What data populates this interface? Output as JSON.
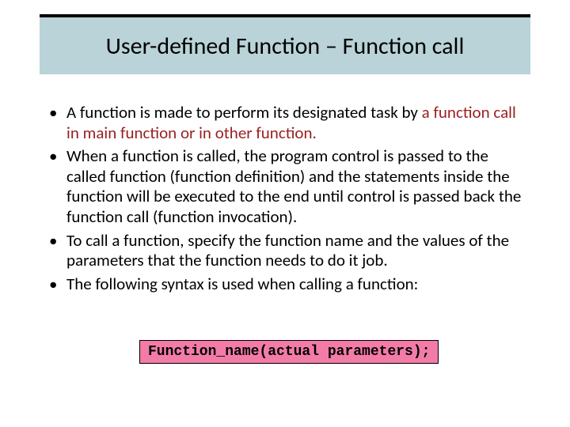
{
  "title": "User-defined Function – Function call",
  "bullets": [
    {
      "pre": "A function is made to perform its designated task by ",
      "hl": "a function call in main function or in other function.",
      "post": ""
    },
    {
      "pre": "When a function is called, the program control is passed to the called function (function definition) and the statements inside the function will be executed to the end until control is passed back the function call (function invocation).",
      "hl": "",
      "post": ""
    },
    {
      "pre": "To call a function, specify the function name and the values of the parameters that the function needs to do it job.",
      "hl": "",
      "post": ""
    },
    {
      "pre": "The following syntax is used when calling a function:",
      "hl": "",
      "post": ""
    }
  ],
  "syntax": "Function_name(actual parameters);"
}
